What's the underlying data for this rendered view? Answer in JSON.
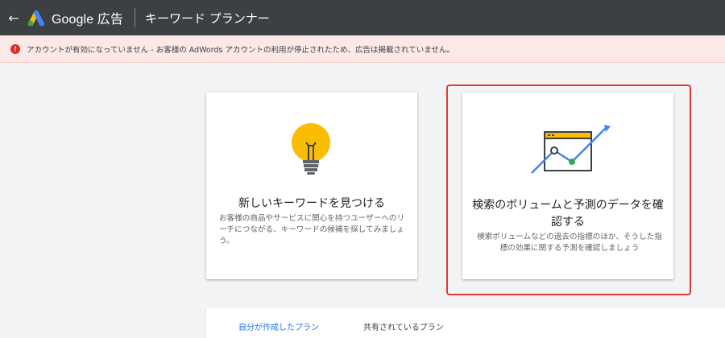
{
  "header": {
    "back_icon": "arrow-back-icon",
    "logo_icon": "google-ads-logo-icon",
    "brand": "Google 広告",
    "page_title": "キーワード プランナー"
  },
  "alert": {
    "icon": "error-icon",
    "icon_glyph": "!",
    "message": "アカウントが有効になっていません - お客様の AdWords アカウントの利用が停止されたため、広告は掲載されていません。"
  },
  "cards": [
    {
      "icon": "lightbulb-icon",
      "title": "新しいキーワードを見つける",
      "description": "お客様の商品やサービスに関心を持つユーザーへのリーチにつながる、キーワードの候補を探してみましょう。"
    },
    {
      "icon": "chart-trend-icon",
      "title": "検索のボリュームと予測のデータを確認する",
      "description": "検索ボリュームなどの過去の指標のほか、そうした指標の効果に関する予測を確認しましょう"
    }
  ],
  "tabs": [
    {
      "label": "自分が作成したプラン",
      "active": true
    },
    {
      "label": "共有されているプラン",
      "active": false
    }
  ],
  "colors": {
    "topbar": "#3c4043",
    "alert_bg": "#fce8e6",
    "alert_icon": "#d93025",
    "accent": "#1a73e8",
    "highlight": "#e53935",
    "bulb": "#fbbc04"
  }
}
